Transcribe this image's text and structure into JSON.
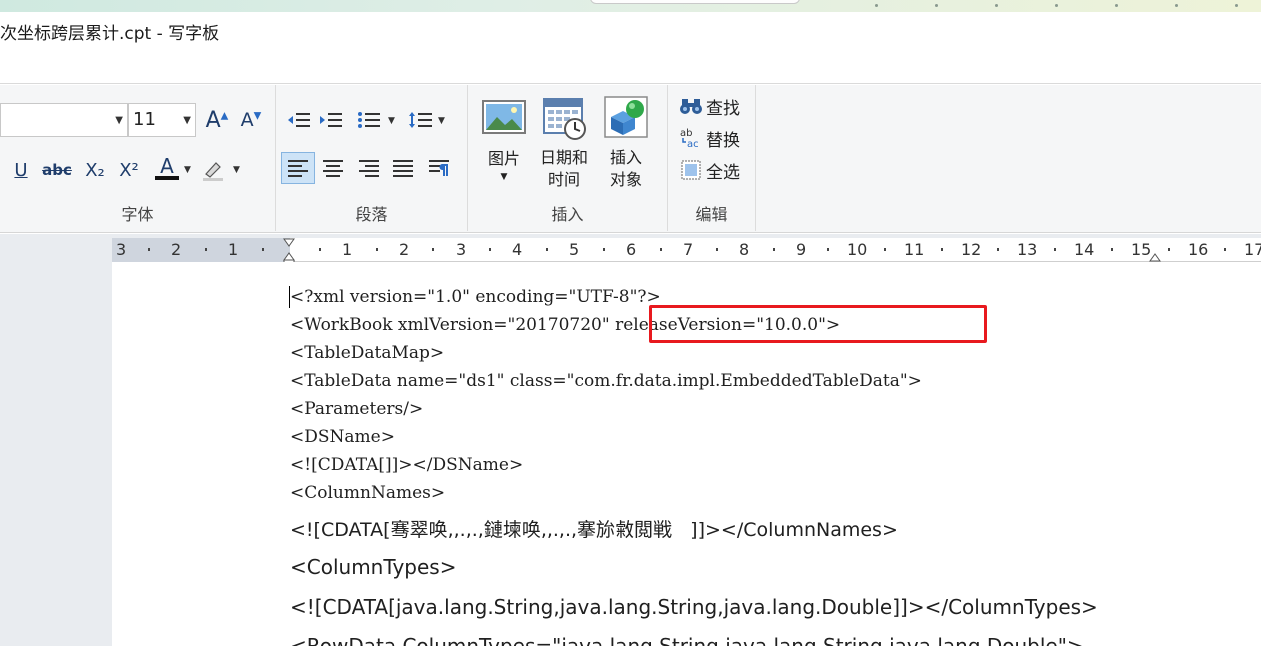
{
  "window": {
    "title": "次坐标跨层累计.cpt - 写字板"
  },
  "ribbon": {
    "font_group": {
      "label": "字体",
      "size_value": "11",
      "underline": "U",
      "strikethrough": "abc",
      "subscript": "X₂",
      "superscript": "X²",
      "font_color_letter": "A"
    },
    "paragraph_group": {
      "label": "段落"
    },
    "insert_group": {
      "label": "插入",
      "picture": "图片",
      "datetime_line1": "日期和",
      "datetime_line2": "时间",
      "object_line1": "插入",
      "object_line2": "对象"
    },
    "edit_group": {
      "label": "编辑",
      "find": "查找",
      "replace": "替换",
      "select_all": "全选"
    }
  },
  "ruler": {
    "labels": [
      "3",
      "2",
      "1",
      "1",
      "2",
      "3",
      "4",
      "5",
      "6",
      "7",
      "8",
      "9",
      "10",
      "11",
      "12",
      "13",
      "14",
      "15",
      "16",
      "17"
    ]
  },
  "document": {
    "lines": [
      "<?xml version=\"1.0\" encoding=\"UTF-8\"?>",
      "<WorkBook xmlVersion=\"20170720\" releaseVersion=\"10.0.0\">",
      "<TableDataMap>",
      "<TableData name=\"ds1\" class=\"com.fr.data.impl.EmbeddedTableData\">",
      "<Parameters/>",
      "<DSName>",
      "<![CDATA[]]></DSName>",
      "<ColumnNames>",
      "<![CDATA[骞翠唤,,.,.,鏈堜唤,,.,.,搴旀敹閲戦   ]]></ColumnNames>",
      "<ColumnTypes>",
      "<![CDATA[java.lang.String,java.lang.String,java.lang.Double]]></ColumnTypes>",
      "<RowData ColumnTypes=\"java.lang.String,java.lang.String,java.lang.Double\">"
    ]
  },
  "colors": {
    "highlight": "#e8191e",
    "ribbon_bg": "#f5f6f7",
    "selected_button": "#cde3f7"
  }
}
